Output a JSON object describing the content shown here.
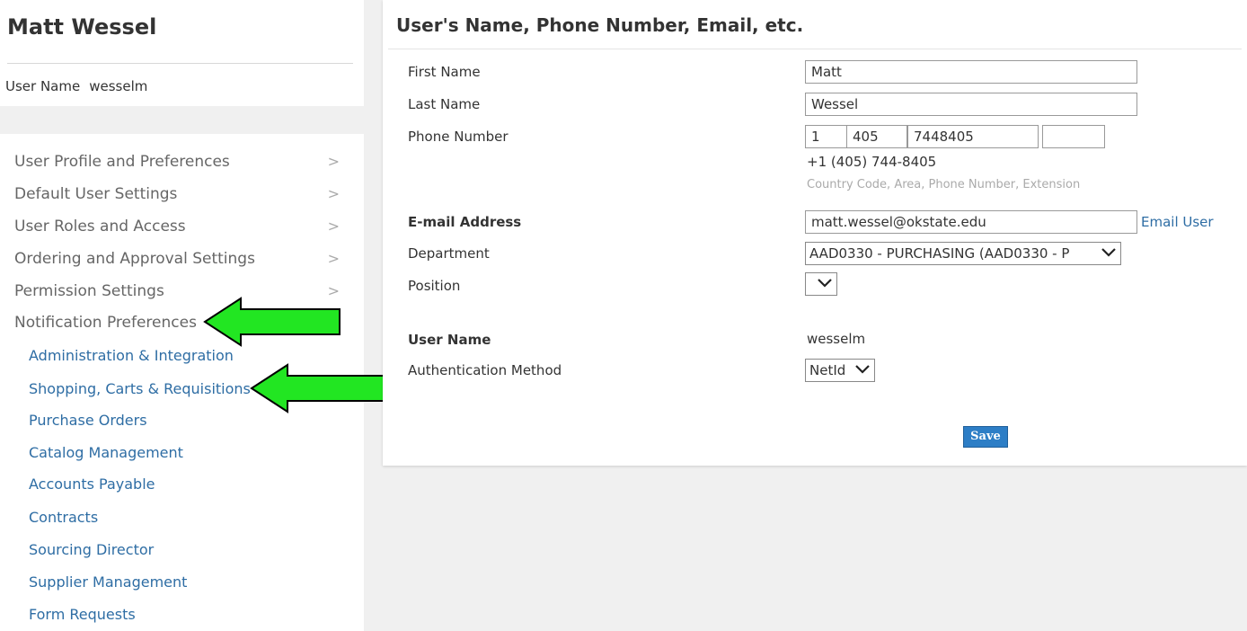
{
  "sidebar": {
    "user_title": "Matt Wessel",
    "username_label": "User Name",
    "username_value": "wesselm",
    "nav_items": [
      {
        "label": "User Profile and Preferences",
        "chevron": ">"
      },
      {
        "label": "Default User Settings",
        "chevron": ">"
      },
      {
        "label": "User Roles and Access",
        "chevron": ">"
      },
      {
        "label": "Ordering and Approval Settings",
        "chevron": ">"
      },
      {
        "label": "Permission Settings",
        "chevron": ">"
      },
      {
        "label": "Notification Preferences",
        "chevron": ""
      }
    ],
    "sub_items": [
      "Administration & Integration",
      "Shopping, Carts & Requisitions",
      "Purchase Orders",
      "Catalog Management",
      "Accounts Payable",
      "Contracts",
      "Sourcing Director",
      "Supplier Management",
      "Form Requests"
    ]
  },
  "main": {
    "title": "User's Name, Phone Number, Email, etc.",
    "fields": {
      "first_name_label": "First Name",
      "first_name_value": "Matt",
      "last_name_label": "Last Name",
      "last_name_value": "Wessel",
      "phone_label": "Phone Number",
      "phone_country": "1",
      "phone_area": "405",
      "phone_number": "7448405",
      "phone_extension": "",
      "phone_formatted": "+1 (405) 744-8405",
      "phone_hint": "Country Code, Area, Phone Number, Extension",
      "email_label": "E-mail Address",
      "email_value": "matt.wessel@okstate.edu",
      "email_user_link": "Email User",
      "department_label": "Department",
      "department_value": "AAD0330 - PURCHASING (AAD0330 - P",
      "position_label": "Position",
      "position_value": "",
      "username_label": "User Name",
      "username_value": "wesselm",
      "auth_label": "Authentication Method",
      "auth_value": "NetId"
    },
    "save_label": "Save"
  },
  "colors": {
    "link": "#2e6da4",
    "annotation_arrow": "#22e622",
    "save_button": "#2d7ec6"
  }
}
